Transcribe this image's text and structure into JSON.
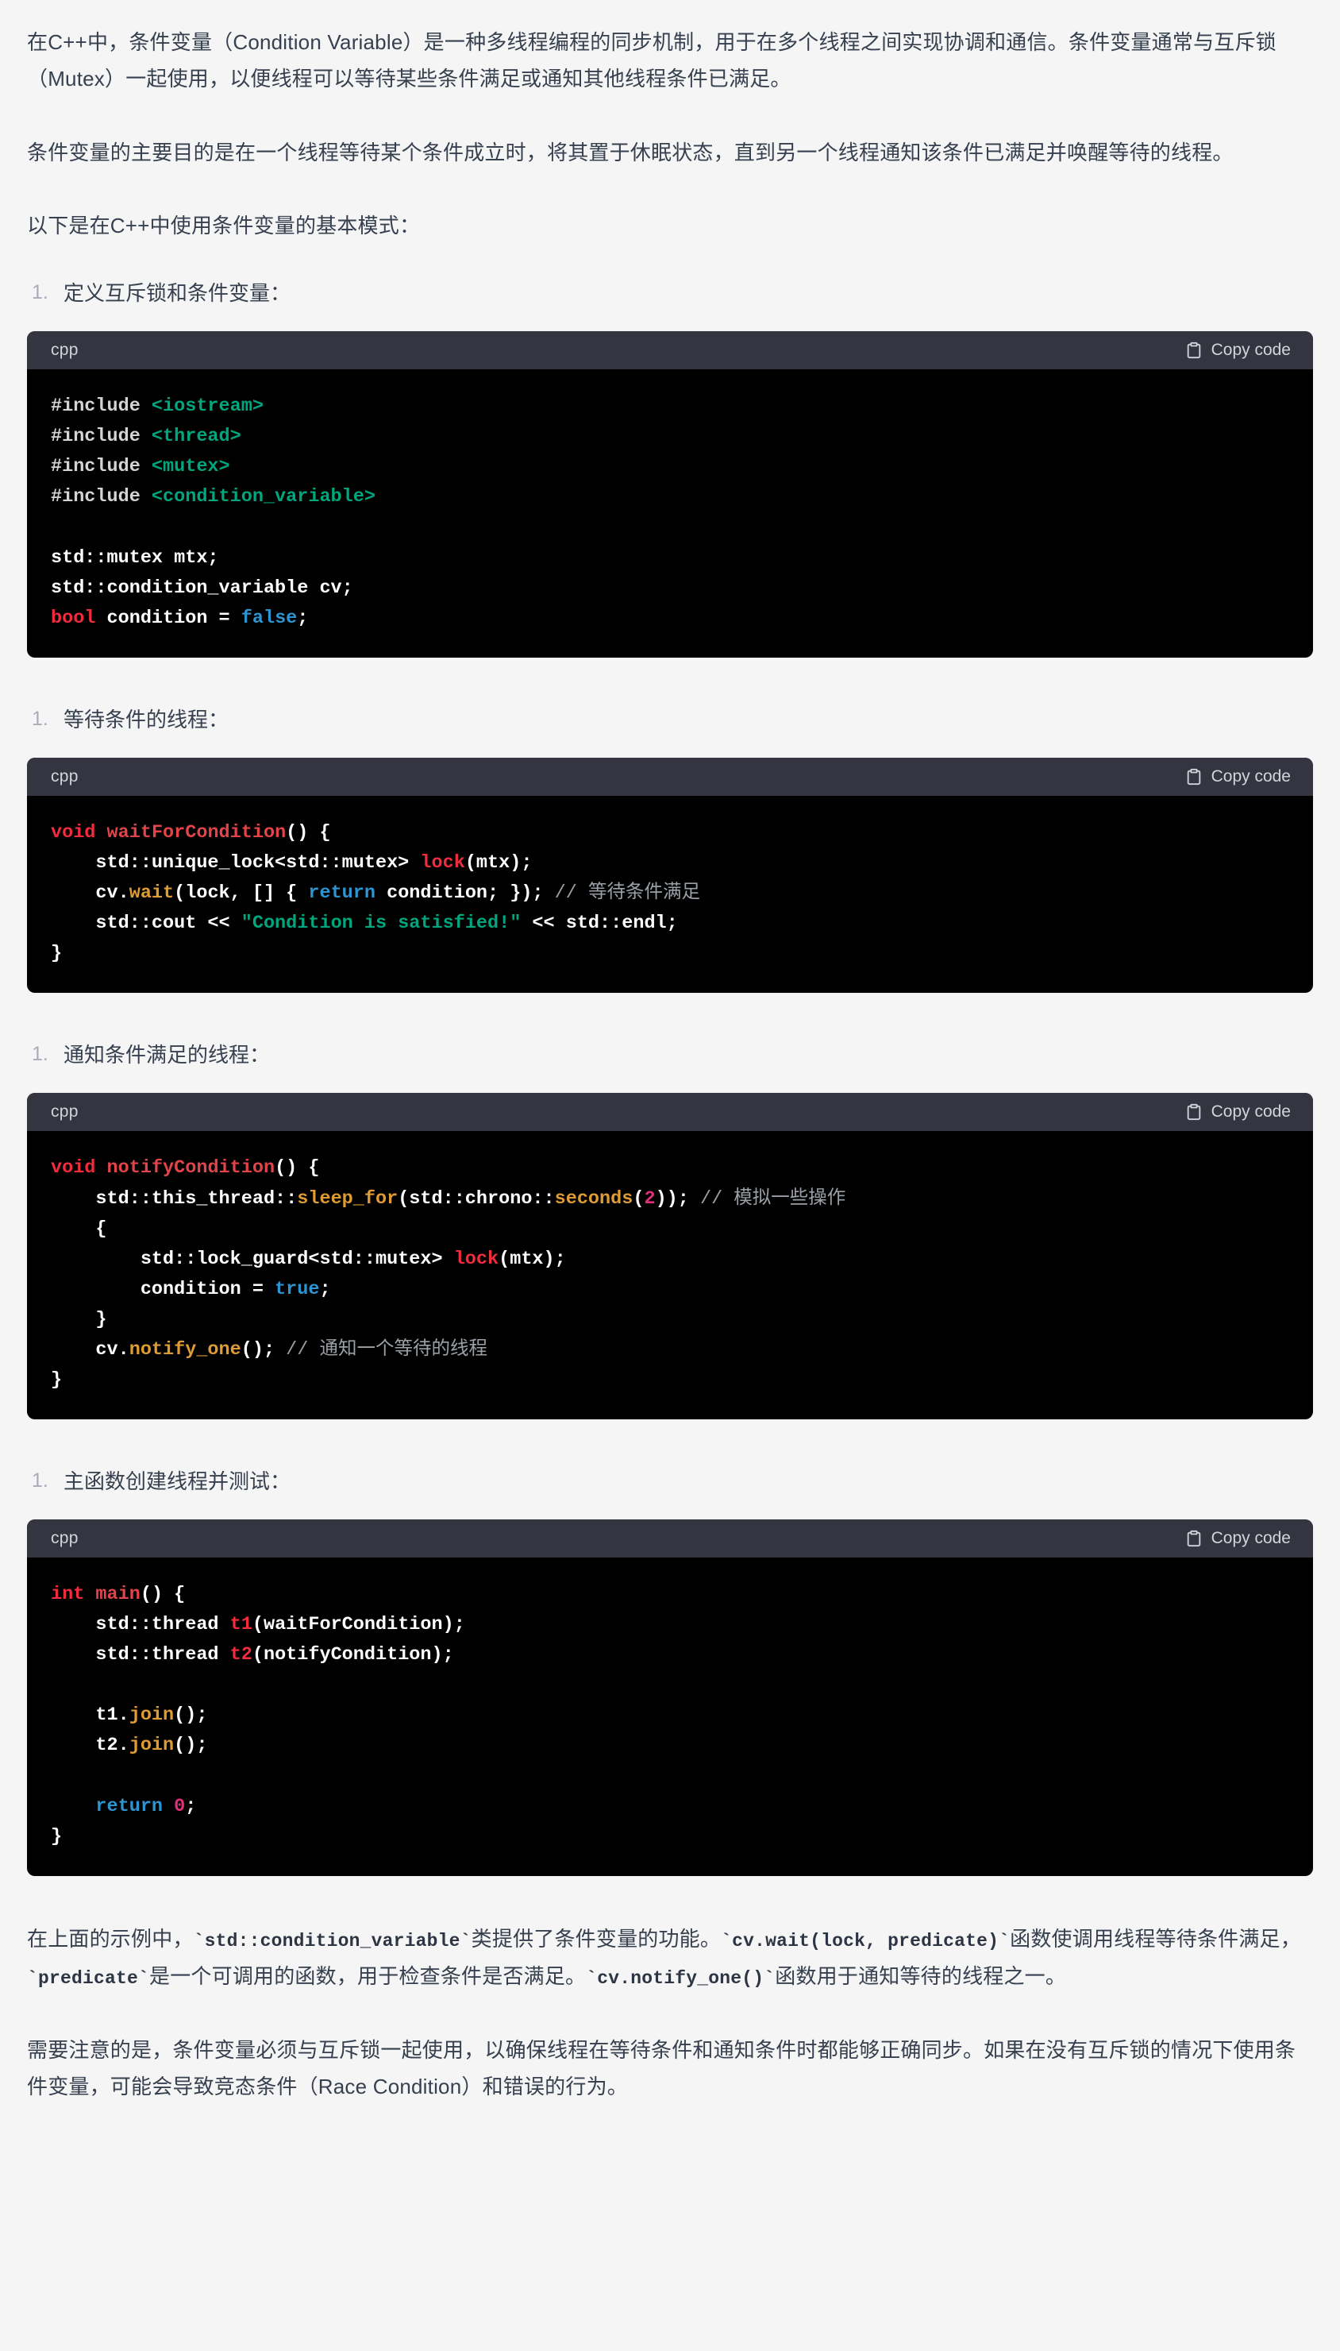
{
  "intro": {
    "paragraph_1": "在C++中，条件变量（Condition Variable）是一种多线程编程的同步机制，用于在多个线程之间实现协调和通信。条件变量通常与互斥锁（Mutex）一起使用，以便线程可以等待某些条件满足或通知其他线程条件已满足。",
    "paragraph_2": "条件变量的主要目的是在一个线程等待某个条件成立时，将其置于休眠状态，直到另一个线程通知该条件已满足并唤醒等待的线程。",
    "paragraph_3": "以下是在C++中使用条件变量的基本模式："
  },
  "code_ui": {
    "language_label": "cpp",
    "copy_label": "Copy code",
    "copy_icon": "clipboard-icon",
    "marker": "1."
  },
  "sections": [
    {
      "heading": "定义互斥锁和条件变量：",
      "code_lines": [
        [
          {
            "t": "pre",
            "s": "#include "
          },
          {
            "t": "str",
            "s": "<iostream>"
          }
        ],
        [
          {
            "t": "pre",
            "s": "#include "
          },
          {
            "t": "str",
            "s": "<thread>"
          }
        ],
        [
          {
            "t": "pre",
            "s": "#include "
          },
          {
            "t": "str",
            "s": "<mutex>"
          }
        ],
        [
          {
            "t": "pre",
            "s": "#include "
          },
          {
            "t": "str",
            "s": "<condition_variable>"
          }
        ],
        [],
        [
          {
            "t": "pl",
            "s": "std::mutex mtx;"
          }
        ],
        [
          {
            "t": "pl",
            "s": "std::condition_variable cv;"
          }
        ],
        [
          {
            "t": "kw",
            "s": "bool"
          },
          {
            "t": "pl",
            "s": " condition = "
          },
          {
            "t": "blue",
            "s": "false"
          },
          {
            "t": "pl",
            "s": ";"
          }
        ]
      ]
    },
    {
      "heading": "等待条件的线程：",
      "code_lines": [
        [
          {
            "t": "kw",
            "s": "void"
          },
          {
            "t": "pl",
            "s": " "
          },
          {
            "t": "fn",
            "s": "waitForCondition"
          },
          {
            "t": "pl",
            "s": "() {"
          }
        ],
        [
          {
            "t": "pl",
            "s": "    std::unique_lock<std::mutex> "
          },
          {
            "t": "var",
            "s": "lock"
          },
          {
            "t": "pl",
            "s": "(mtx);"
          }
        ],
        [
          {
            "t": "pl",
            "s": "    cv."
          },
          {
            "t": "or",
            "s": "wait"
          },
          {
            "t": "pl",
            "s": "(lock, [] { "
          },
          {
            "t": "blue",
            "s": "return"
          },
          {
            "t": "pl",
            "s": " condition; }); "
          },
          {
            "t": "cmt",
            "s": "// 等待条件满足"
          }
        ],
        [
          {
            "t": "pl",
            "s": "    std::cout << "
          },
          {
            "t": "str",
            "s": "\"Condition is satisfied!\""
          },
          {
            "t": "pl",
            "s": " << std::endl;"
          }
        ],
        [
          {
            "t": "pl",
            "s": "}"
          }
        ]
      ]
    },
    {
      "heading": "通知条件满足的线程：",
      "code_lines": [
        [
          {
            "t": "kw",
            "s": "void"
          },
          {
            "t": "pl",
            "s": " "
          },
          {
            "t": "fn",
            "s": "notifyCondition"
          },
          {
            "t": "pl",
            "s": "() {"
          }
        ],
        [
          {
            "t": "pl",
            "s": "    std::this_thread::"
          },
          {
            "t": "or",
            "s": "sleep_for"
          },
          {
            "t": "pl",
            "s": "(std::chrono::"
          },
          {
            "t": "or",
            "s": "seconds"
          },
          {
            "t": "pl",
            "s": "("
          },
          {
            "t": "num",
            "s": "2"
          },
          {
            "t": "pl",
            "s": ")); "
          },
          {
            "t": "cmt",
            "s": "// 模拟一些操作"
          }
        ],
        [
          {
            "t": "pl",
            "s": "    {"
          }
        ],
        [
          {
            "t": "pl",
            "s": "        std::lock_guard<std::mutex> "
          },
          {
            "t": "var",
            "s": "lock"
          },
          {
            "t": "pl",
            "s": "(mtx);"
          }
        ],
        [
          {
            "t": "pl",
            "s": "        condition = "
          },
          {
            "t": "blue",
            "s": "true"
          },
          {
            "t": "pl",
            "s": ";"
          }
        ],
        [
          {
            "t": "pl",
            "s": "    }"
          }
        ],
        [
          {
            "t": "pl",
            "s": "    cv."
          },
          {
            "t": "or",
            "s": "notify_one"
          },
          {
            "t": "pl",
            "s": "(); "
          },
          {
            "t": "cmt",
            "s": "// 通知一个等待的线程"
          }
        ],
        [
          {
            "t": "pl",
            "s": "}"
          }
        ]
      ]
    },
    {
      "heading": "主函数创建线程并测试：",
      "code_lines": [
        [
          {
            "t": "kw",
            "s": "int"
          },
          {
            "t": "pl",
            "s": " "
          },
          {
            "t": "fn",
            "s": "main"
          },
          {
            "t": "pl",
            "s": "() {"
          }
        ],
        [
          {
            "t": "pl",
            "s": "    std::thread "
          },
          {
            "t": "var",
            "s": "t1"
          },
          {
            "t": "pl",
            "s": "(waitForCondition);"
          }
        ],
        [
          {
            "t": "pl",
            "s": "    std::thread "
          },
          {
            "t": "var",
            "s": "t2"
          },
          {
            "t": "pl",
            "s": "(notifyCondition);"
          }
        ],
        [],
        [
          {
            "t": "pl",
            "s": "    t1."
          },
          {
            "t": "or",
            "s": "join"
          },
          {
            "t": "pl",
            "s": "();"
          }
        ],
        [
          {
            "t": "pl",
            "s": "    t2."
          },
          {
            "t": "or",
            "s": "join"
          },
          {
            "t": "pl",
            "s": "();"
          }
        ],
        [],
        [
          {
            "t": "pl",
            "s": "    "
          },
          {
            "t": "blue",
            "s": "return"
          },
          {
            "t": "pl",
            "s": " "
          },
          {
            "t": "num",
            "s": "0"
          },
          {
            "t": "pl",
            "s": ";"
          }
        ],
        [
          {
            "t": "pl",
            "s": "}"
          }
        ]
      ]
    }
  ],
  "outro": {
    "paragraph_1_parts": [
      {
        "type": "text",
        "s": "在上面的示例中，"
      },
      {
        "type": "code",
        "s": "`std::condition_variable`"
      },
      {
        "type": "text",
        "s": "类提供了条件变量的功能。"
      },
      {
        "type": "code",
        "s": "`cv.wait(lock, predicate)`"
      },
      {
        "type": "text",
        "s": "函数使调用线程等待条件满足，"
      },
      {
        "type": "code",
        "s": "`predicate`"
      },
      {
        "type": "text",
        "s": "是一个可调用的函数，用于检查条件是否满足。"
      },
      {
        "type": "code",
        "s": "`cv.notify_one()`"
      },
      {
        "type": "text",
        "s": "函数用于通知等待的线程之一。"
      }
    ],
    "paragraph_2": "需要注意的是，条件变量必须与互斥锁一起使用，以确保线程在等待条件和通知条件时都能够正确同步。如果在没有互斥锁的情况下使用条件变量，可能会导致竞态条件（Race Condition）和错误的行为。"
  },
  "colors": {
    "page_background": "#f5f5f5",
    "body_text": "#37404f",
    "code_header_background": "#343541",
    "code_background": "#000000",
    "marker": "#a7adba"
  }
}
